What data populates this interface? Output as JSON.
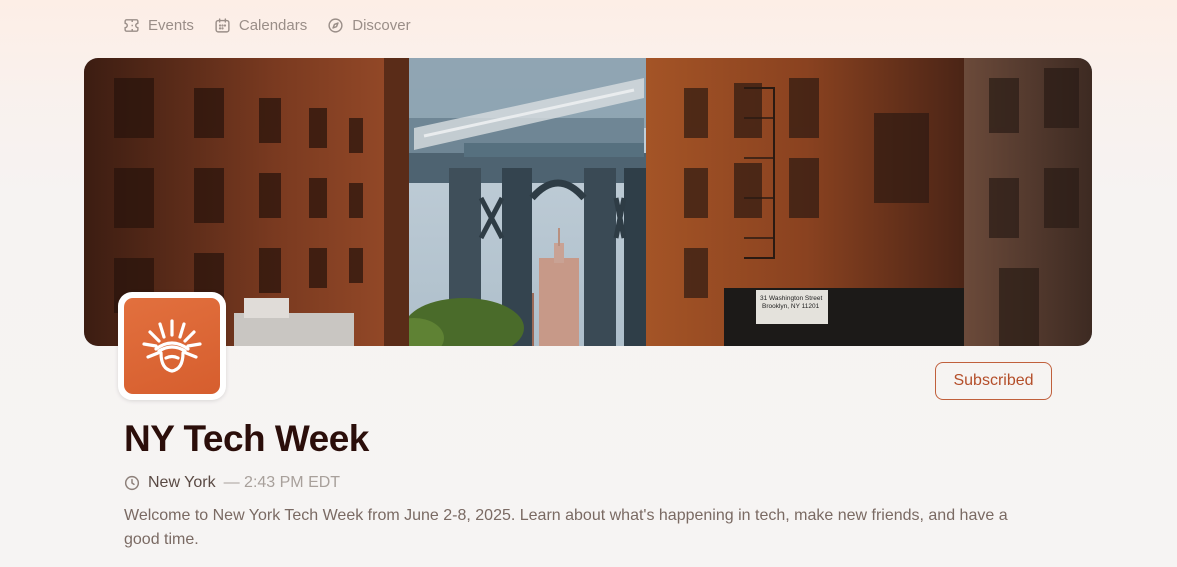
{
  "nav": {
    "items": [
      {
        "label": "Events",
        "icon": "ticket-icon"
      },
      {
        "label": "Calendars",
        "icon": "calendar-icon"
      },
      {
        "label": "Discover",
        "icon": "compass-icon"
      }
    ]
  },
  "calendar": {
    "title": "NY Tech Week",
    "city": "New York",
    "time": "— 2:43 PM EDT",
    "description": "Welcome to New York Tech Week from June 2-8, 2025. Learn about what's happening in tech, make new friends, and have a good time.",
    "subscribe_label": "Subscribed",
    "cover_image": "Manhattan Bridge viewed between brick buildings in DUMBO, Brooklyn",
    "cover_sign_text": [
      "31 Washington Street",
      "Brooklyn, NY 11201"
    ],
    "avatar_icon": "statue-of-liberty-crown-icon"
  },
  "colors": {
    "accent": "#d65e2e",
    "button_border": "#c0603c",
    "title": "#2b0e0a",
    "muted": "#9a8e88"
  }
}
